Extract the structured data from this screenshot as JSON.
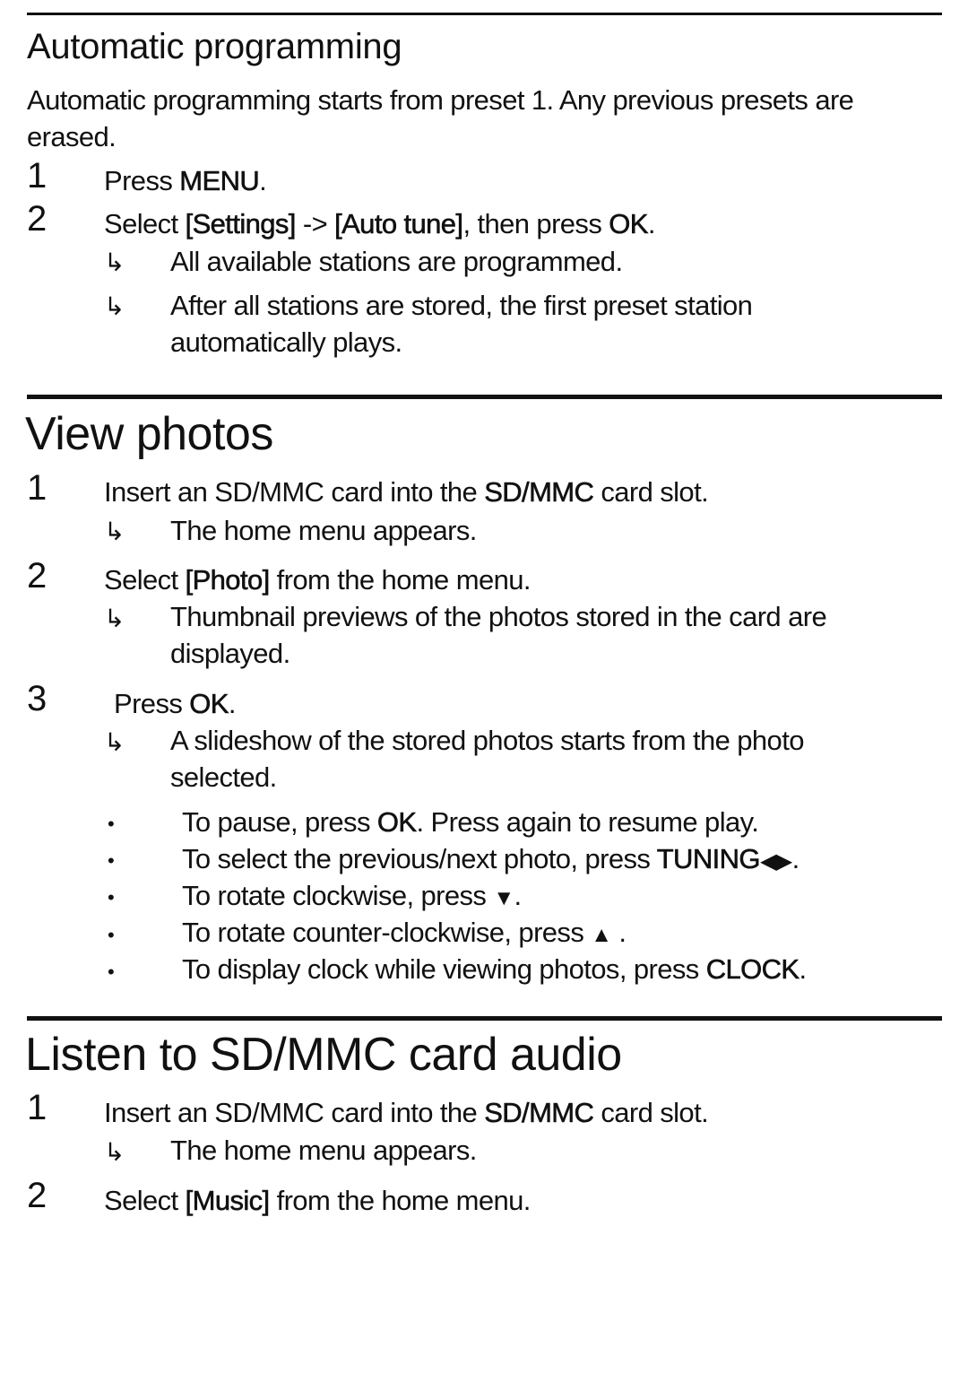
{
  "section_auto": {
    "title": "Automatic programming",
    "intro_line1": "Automatic programming starts from preset 1. Any previous presets are",
    "intro_line2": "erased.",
    "step1_num": "1",
    "step1_pre": "Press ",
    "step1_bold": "MENU",
    "step1_post": ".",
    "step2_num": "2",
    "step2_a": "Select ",
    "step2_b": "[Settings]",
    "step2_c": " -> ",
    "step2_d": "[Auto tune]",
    "step2_e": ", then press ",
    "step2_f": "OK",
    "step2_g": ".",
    "result1": "All available stations are programmed.",
    "result2_line1": "After all stations are stored, the first preset station",
    "result2_line2": "automatically plays."
  },
  "section_photos": {
    "title": "View photos",
    "step1_num": "1",
    "step1_a": "Insert an SD/MMC card into the ",
    "step1_b": "SD/MMC",
    "step1_c": " card slot.",
    "step1_result": "The home menu appears.",
    "step2_num": "2",
    "step2_a": "Select ",
    "step2_b": "[Photo]",
    "step2_c": " from the home menu.",
    "step2_result_line1": "Thumbnail previews of the photos stored in the card are",
    "step2_result_line2": "displayed.",
    "step3_num": "3",
    "step3_a": "Press ",
    "step3_b": "OK",
    "step3_c": ".",
    "step3_result_line1": "A slideshow of the stored photos starts from the photo",
    "step3_result_line2": "selected.",
    "bullets": [
      {
        "a": "To pause, press ",
        "b": "OK",
        "c": ". Press again to resume play."
      },
      {
        "a": "To select the previous/next photo, press ",
        "b": "TUNING",
        "c": "."
      },
      {
        "a": "To rotate clockwise, press ",
        "c": "."
      },
      {
        "a": "To rotate counter-clockwise, press ",
        "c": " ."
      },
      {
        "a": "To display clock while viewing photos, press ",
        "b": "CLOCK",
        "c": "."
      }
    ],
    "bullet_symbol": "•",
    "arrow_symbol": "↳",
    "icons": {
      "left_right": "◀▶",
      "down": "▼",
      "up": "▲"
    }
  },
  "section_audio": {
    "title": "Listen to SD/MMC card audio",
    "step1_num": "1",
    "step1_a": "Insert an SD/MMC card into the ",
    "step1_b": "SD/MMC",
    "step1_c": " card slot.",
    "step1_result": "The home menu appears.",
    "step2_num": "2",
    "step2_a": "Select ",
    "step2_b": "[Music]",
    "step2_c": " from the home menu."
  }
}
